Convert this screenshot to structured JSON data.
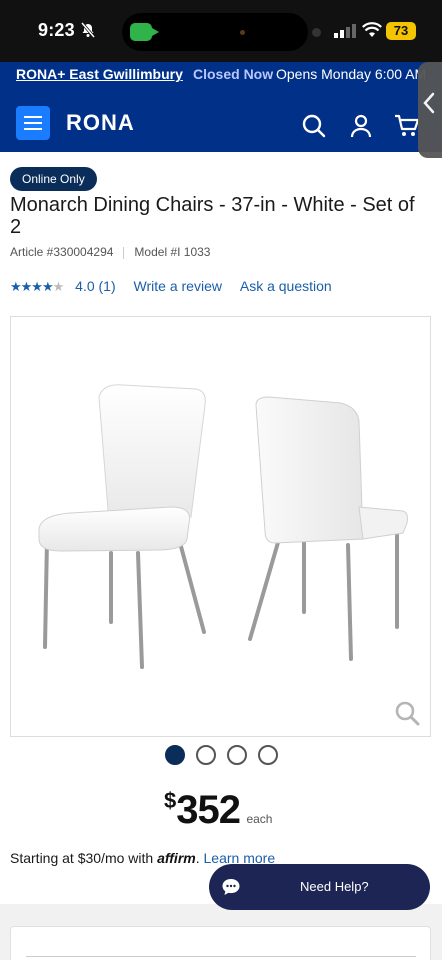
{
  "status_bar": {
    "time": "9:23",
    "battery": "73"
  },
  "store_bar": {
    "store_name": "RONA+ East Gwillimbury",
    "status": "Closed Now",
    "hours": "Opens Monday 6:00 AM"
  },
  "header": {
    "logo": "RONA"
  },
  "product": {
    "badge": "Online Only",
    "title": "Monarch Dining Chairs - 37-in - White - Set of 2",
    "article": "Article #330004294",
    "model": "Model #I 1033",
    "rating_value": 4.0,
    "rating_text": "4.0 (1)",
    "write_review": "Write a review",
    "ask_question": "Ask a question"
  },
  "gallery": {
    "image_count": 4,
    "active_index": 0
  },
  "price": {
    "currency": "$",
    "amount": "352",
    "unit": "each"
  },
  "financing": {
    "prefix": "Starting at $30/mo with",
    "brand": "affirm",
    "suffix": ".",
    "link": "Learn more"
  },
  "help": {
    "label": "Need Help?"
  },
  "colors": {
    "brand_blue": "#003087",
    "menu_blue": "#1a7cff",
    "badge_navy": "#0b2d5a",
    "link_blue": "#1b5fa8",
    "help_navy": "#1c2553"
  }
}
